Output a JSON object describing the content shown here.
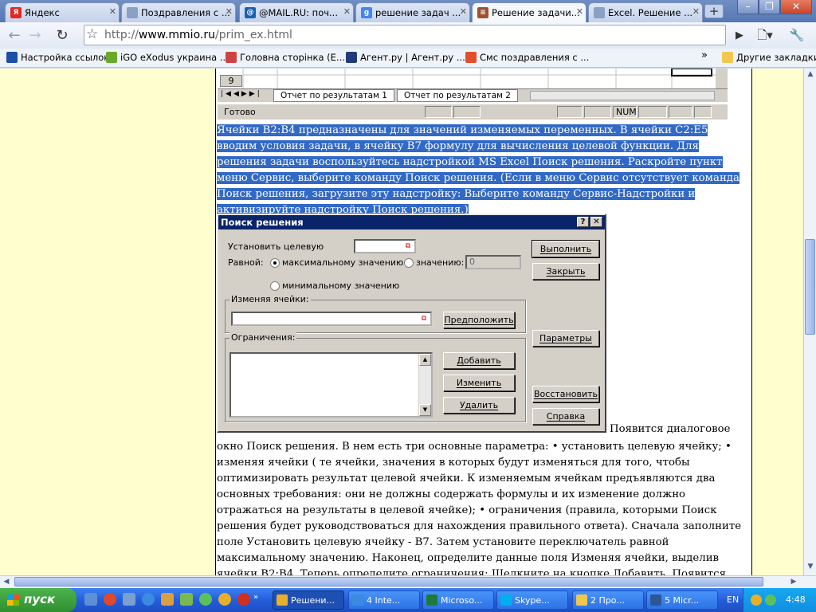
{
  "browser": {
    "tabs": [
      {
        "title": "Яндекс",
        "favicon": "yandex-icon",
        "color": "#e52620",
        "glyph": "Я"
      },
      {
        "title": "Поздравления с ...",
        "favicon": "page-icon",
        "color": "#8aa0c4",
        "glyph": ""
      },
      {
        "title": "@MAIL.RU: поч...",
        "favicon": "mailru-icon",
        "color": "#1a60b0",
        "glyph": "@"
      },
      {
        "title": "решение задач ...",
        "favicon": "google-icon",
        "color": "#4285f4",
        "glyph": "g"
      },
      {
        "title": "Решение задачи...",
        "favicon": "mmio-icon",
        "color": "#a05030",
        "glyph": "≡",
        "active": true
      },
      {
        "title": "Excel. Решение ...",
        "favicon": "page-icon",
        "color": "#8aa0c4",
        "glyph": ""
      }
    ],
    "url_prefix": "http://",
    "url_domain": "www.mmio.ru",
    "url_path": "/prim_ex.html",
    "bookmarks": [
      {
        "label": "Настройка ссылок",
        "icon": "m-icon",
        "color": "#1d4ea8"
      },
      {
        "label": "iGO eXodus украина ...",
        "icon": "leaf-icon",
        "color": "#6aa82a"
      },
      {
        "label": "Головна сторінка (Е...",
        "icon": "page-icon",
        "color": "#c44"
      },
      {
        "label": "Агент.ру | Агент.ру ...",
        "icon": "agent-icon",
        "color": "#223b7a"
      },
      {
        "label": "Смс поздравления с ...",
        "icon": "sms-icon",
        "color": "#e0502a"
      }
    ],
    "other_bookmarks": "Другие закладки"
  },
  "excel": {
    "row_number": "9",
    "sheet_tabs": [
      "Отчет по результатам 1",
      "Отчет по результатам 2"
    ],
    "status": "Готово",
    "num": "NUM"
  },
  "article": {
    "highlighted_paragraph": "Ячейки В2:В4 предназначены для значений изменяемых переменных. В ячейки С2:Е5 вводим условия задачи, в ячейку В7 формулу для вычисления целевой функции. Для решения задачи воспользуйтесь надстройкой MS Excel Поиск решения. Раскройте пункт меню Сервис, выберите команду Поиск решения. (Если в меню Сервис отсутствует команда Поиск решения, загрузите эту надстройку: Выберите команду Сервис-Надстройки и активизируйте надстройку Поиск решения.)",
    "after_dialog_inline": "Появится диалоговое",
    "body": "окно Поиск решения. В нем есть три основные параметра: • установить целевую ячейку; • изменяя ячейки ( те ячейки, значения в которых будут изменяться для того, чтобы оптимизировать результат целевой ячейки. К изменяемым ячейкам предъявляются два основных требования: они не должны содержать формулы и их изменение должно отражаться на результаты в целевой ячейке); • ограничения (правила, которыми Поиск решения будет руководствоваться для нахождения правильного ответа). Сначала заполните поле Установить целевую ячейку - В7. Затем установите переключатель равной максимальному значению. Наконец, определите данные поля Изменяя ячейки, выделив ячейки В2:В4. Теперь определите ограничения: Щелкните на кнопке Добавить. Появится диалоговое окно Добавление"
  },
  "solver": {
    "title": "Поиск решения",
    "help_btn": "?",
    "close_btn": "✕",
    "target_label": "Установить целевую",
    "equal_label": "Равной:",
    "max_label": "максимальному значению",
    "value_label": "значению:",
    "value_field": "0",
    "min_label": "минимальному значению",
    "changing_label": "Изменяя ячейки:",
    "guess_btn": "Предположить",
    "constraints_label": "Ограничения:",
    "add_btn": "Добавить",
    "change_btn": "Изменить",
    "delete_btn": "Удалить",
    "solve_btn": "Выполнить",
    "close_button": "Закрыть",
    "options_btn": "Параметры",
    "reset_btn": "Восстановить",
    "help_button": "Справка"
  },
  "taskbar": {
    "start": "пуск",
    "tasks": [
      {
        "label": "Решени...",
        "icon": "chrome-icon",
        "color": "#e8b02a",
        "active": true
      },
      {
        "label": "4 Inte...",
        "icon": "ie-icon",
        "color": "#3a8be0"
      },
      {
        "label": "Microso...",
        "icon": "excel-icon",
        "color": "#1e7a3a"
      },
      {
        "label": "Skype...",
        "icon": "skype-icon",
        "color": "#00aff0"
      },
      {
        "label": "2 Про...",
        "icon": "folder-icon",
        "color": "#f0c850"
      },
      {
        "label": "5 Micr...",
        "icon": "word-icon",
        "color": "#2b5797"
      }
    ],
    "lang": "EN",
    "time": "4:48"
  }
}
